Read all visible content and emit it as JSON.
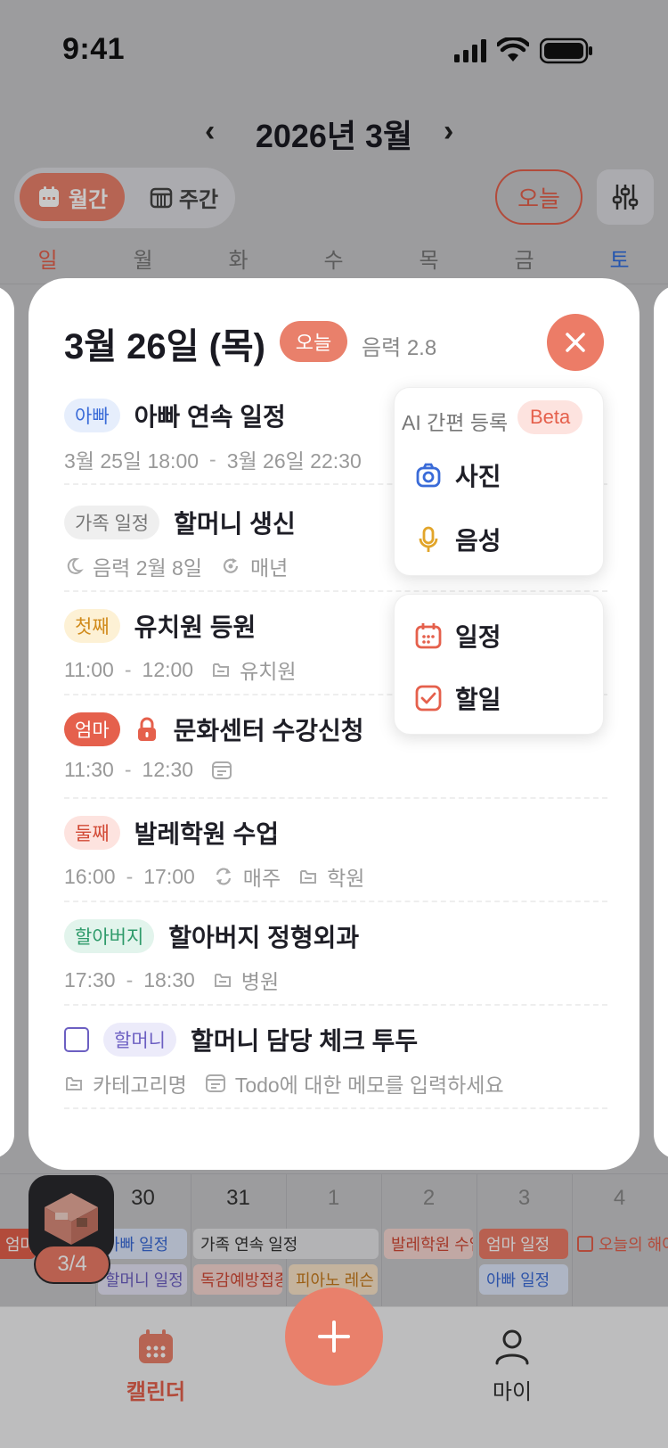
{
  "status": {
    "time": "9:41"
  },
  "header": {
    "title": "2026년 3월",
    "prev": "‹",
    "next": "›"
  },
  "view_toggle": {
    "monthly": "월간",
    "weekly": "주간"
  },
  "today_button": "오늘",
  "weekdays": [
    "일",
    "월",
    "화",
    "수",
    "목",
    "금",
    "토"
  ],
  "bottom_week": {
    "days": [
      "30",
      "31",
      "1",
      "2",
      "3",
      "4"
    ],
    "chips": {
      "c1": "아빠 일정",
      "c2": "할머니 일정",
      "c3": "가족 연속 일정",
      "c4": "독감예방접종",
      "c5": "피아노 레슨",
      "c6": "발레학원 수업",
      "c7": "엄마 일정",
      "c8": "아빠 일정",
      "c9": "오늘의 해야",
      "c10": "엄마"
    }
  },
  "badge": {
    "counter": "3/4"
  },
  "tabbar": {
    "calendar": "캘린더",
    "my": "마이"
  },
  "modal": {
    "date": "3월 26일 (목)",
    "today_tag": "오늘",
    "lunar": "음력 2.8",
    "events": [
      {
        "tag": "아빠",
        "title": "아빠 연속 일정",
        "time": "3월 25일 18:00",
        "time_end": "3월 26일 22:30"
      },
      {
        "tag": "가족 일정",
        "title": "할머니 생신",
        "lunar": "음력 2월 8일",
        "repeat": "매년"
      },
      {
        "tag": "첫째",
        "title": "유치원 등원",
        "time": "11:00",
        "time_end": "12:00",
        "category": "유치원"
      },
      {
        "tag": "엄마",
        "title": "문화센터 수강신청",
        "time": "11:30",
        "time_end": "12:30"
      },
      {
        "tag": "둘째",
        "title": "발레학원 수업",
        "time": "16:00",
        "time_end": "17:00",
        "repeat": "매주",
        "category": "학원"
      },
      {
        "tag": "할아버지",
        "title": "할아버지 정형외과",
        "time": "17:30",
        "time_end": "18:30",
        "category": "병원"
      },
      {
        "tag": "할머니",
        "title": "할머니 담당 체크 투두",
        "category": "카테고리명",
        "memo": "Todo에 대한 메모를 입력하세요"
      }
    ],
    "time_sep": "-"
  },
  "ai_menu": {
    "title": "AI 간편 등록",
    "beta": "Beta",
    "photo": "사진",
    "voice": "음성"
  },
  "add_menu": {
    "schedule": "일정",
    "todo": "할일"
  },
  "colors": {
    "accent": "#e9806b",
    "danger": "#e5604c"
  }
}
